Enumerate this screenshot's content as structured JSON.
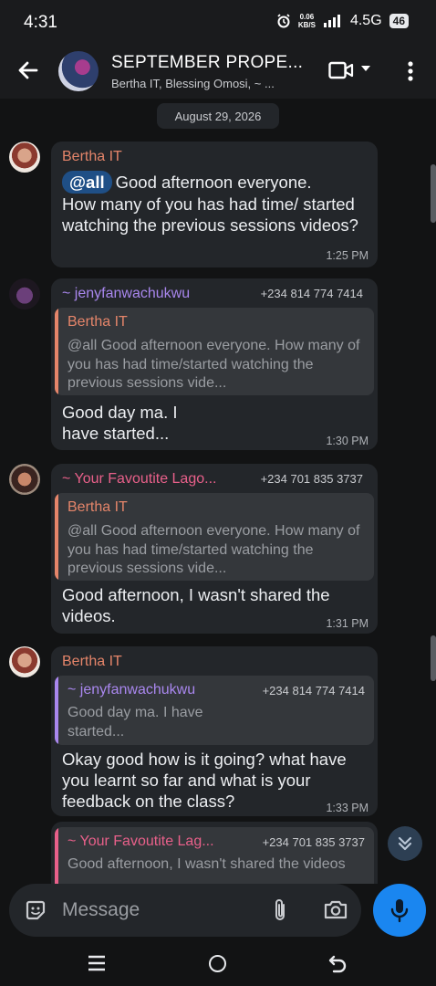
{
  "status_bar": {
    "time": "4:31",
    "net_speed_value": "0.06",
    "net_speed_unit": "KB/S",
    "network": "4.5G",
    "battery": "46",
    "icons": [
      "alarm-icon",
      "signal-icon"
    ]
  },
  "header": {
    "title": "SEPTEMBER PROPE...",
    "subtitle": "Bertha IT, Blessing Omosi, ~ ...",
    "icons": [
      "back-arrow-icon",
      "video-call-icon",
      "chevron-down-icon",
      "more-vert-icon"
    ]
  },
  "chat": {
    "date": "August 29, 2026",
    "messages": [
      {
        "sender": "Bertha IT",
        "sender_color": "#e5856a",
        "mention": "@all",
        "text_line1": "Good afternoon everyone.",
        "text_rest": "How many of you has had time/ started watching the previous sessions videos?",
        "time": "1:25 PM"
      },
      {
        "sender": "~ jenyfanwachukwu",
        "sender_color": "#a987ee",
        "phone": "+234 814 774 7414",
        "quote_name": "Bertha IT",
        "quote_color": "#e5856a",
        "quote_text": "@all Good afternoon everyone. How many of you has had time/started watching the previous sessions vide...",
        "text": "Good day ma. I have started...",
        "time": "1:30 PM"
      },
      {
        "sender": "~ Your Favoutite Lago...",
        "sender_color": "#e8608a",
        "phone": "+234 701 835 3737",
        "quote_name": "Bertha IT",
        "quote_color": "#e5856a",
        "quote_text": "@all Good afternoon everyone. How many of you has had time/started watching the previous sessions vide...",
        "text": "Good afternoon, I wasn't shared the videos.",
        "time": "1:31 PM"
      },
      {
        "sender": "Bertha IT",
        "sender_color": "#e5856a",
        "quote_name": "~ jenyfanwachukwu",
        "quote_color": "#a987ee",
        "quote_phone": "+234 814 774 7414",
        "quote_text": "Good day ma. I have started...",
        "text": "Okay good how is it going? what have you learnt so far and what is your feedback on the class?",
        "time": "1:33 PM"
      },
      {
        "quote_name": "~ Your Favoutite Lag...",
        "quote_color": "#e8608a",
        "quote_phone": "+234 701 835 3737",
        "quote_text": "Good afternoon, I wasn't shared the videos"
      }
    ]
  },
  "input": {
    "placeholder": "Message",
    "icons": [
      "emoji-icon",
      "attach-icon",
      "camera-icon",
      "mic-icon"
    ]
  },
  "nav": {
    "icons": [
      "recents-icon",
      "home-icon",
      "back-icon"
    ]
  },
  "colors": {
    "background": "#121314",
    "bubble": "#23262a",
    "quote": "#34373b",
    "mention": "#1f4f86",
    "mic_button": "#1a86f0"
  }
}
